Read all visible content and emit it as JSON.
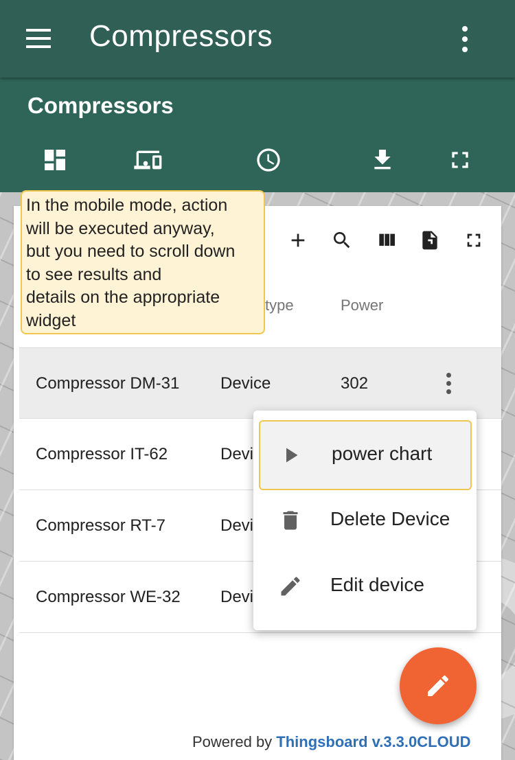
{
  "app": {
    "title": "Compressors"
  },
  "dashboard": {
    "title": "Compressors",
    "toolbar": [
      "dashboard-icon",
      "devices-icon",
      "clock-icon",
      "download-icon",
      "fullscreen-icon"
    ]
  },
  "table": {
    "header_icons": [
      "add-icon",
      "search-icon",
      "columns-icon",
      "export-icon",
      "fullscreen-icon"
    ],
    "columns": {
      "type_partial": "type",
      "power": "Power"
    },
    "rows": [
      {
        "name": "Compressor DM-31",
        "type": "Device",
        "power": "302"
      },
      {
        "name": "Compressor IT-62",
        "type": "Devi"
      },
      {
        "name": "Compressor RT-7",
        "type": "Devi"
      },
      {
        "name": "Compressor WE-32",
        "type": "Devi"
      }
    ]
  },
  "tooltip": {
    "lines": [
      "In the mobile mode, action",
      "will be executed anyway,",
      "but you need to scroll down",
      "to see results and",
      "details on the appropriate",
      "widget"
    ]
  },
  "context_menu": {
    "items": [
      {
        "label": "power chart",
        "icon": "play-icon"
      },
      {
        "label": "Delete Device",
        "icon": "trash-icon"
      },
      {
        "label": "Edit device",
        "icon": "pencil-icon"
      }
    ]
  },
  "footer": {
    "prefix": "Powered by ",
    "link": "Thingsboard v.3.3.0CLOUD"
  },
  "colors": {
    "primary": "#305f56",
    "accent": "#f06434",
    "highlight": "#f0c64e"
  }
}
